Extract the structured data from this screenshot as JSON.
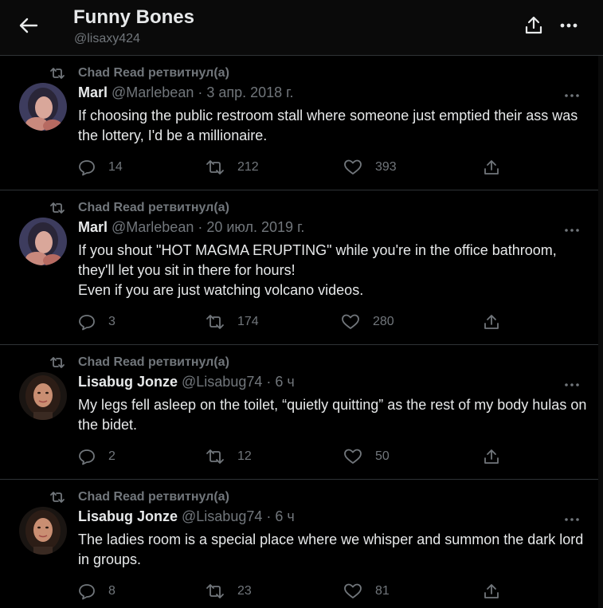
{
  "header": {
    "title": "Funny Bones",
    "handle": "@lisaxy424"
  },
  "tweets": [
    {
      "retweeted_by": "Chad Read ретвитнул(а)",
      "author": "Marl",
      "meta": "@Marlebean · 3 апр. 2018 г.",
      "text": "If choosing the public restroom stall where someone just emptied their ass was the lottery, I'd be a millionaire.",
      "replies": "14",
      "retweets": "212",
      "likes": "393"
    },
    {
      "retweeted_by": "Chad Read ретвитнул(а)",
      "author": "Marl",
      "meta": "@Marlebean · 20 июл. 2019 г.",
      "text": "If you shout \"HOT MAGMA ERUPTING\" while you're in the office bathroom, they'll let you sit in there for hours!\nEven if you are just watching volcano videos.",
      "replies": "3",
      "retweets": "174",
      "likes": "280"
    },
    {
      "retweeted_by": "Chad Read ретвитнул(а)",
      "author": "Lisabug Jonze",
      "meta": "@Lisabug74 · 6 ч",
      "text": "My legs fell asleep on the toilet, “quietly quitting” as the rest of my body hulas on the bidet.",
      "replies": "2",
      "retweets": "12",
      "likes": "50"
    },
    {
      "retweeted_by": "Chad Read ретвитнул(а)",
      "author": "Lisabug Jonze",
      "meta": "@Lisabug74 · 6 ч",
      "text": "The ladies room is a special place where we whisper and summon the dark lord in groups.",
      "replies": "8",
      "retweets": "23",
      "likes": "81"
    }
  ],
  "icons": {
    "back": "arrow-left-icon",
    "share": "share-icon",
    "more": "more-horizontal-icon",
    "retweet": "retweet-icon",
    "reply": "reply-icon",
    "like": "heart-icon"
  },
  "colors": {
    "background": "#000000",
    "text": "#e7e9ea",
    "secondary": "#71767b",
    "divider": "#2f3336"
  }
}
